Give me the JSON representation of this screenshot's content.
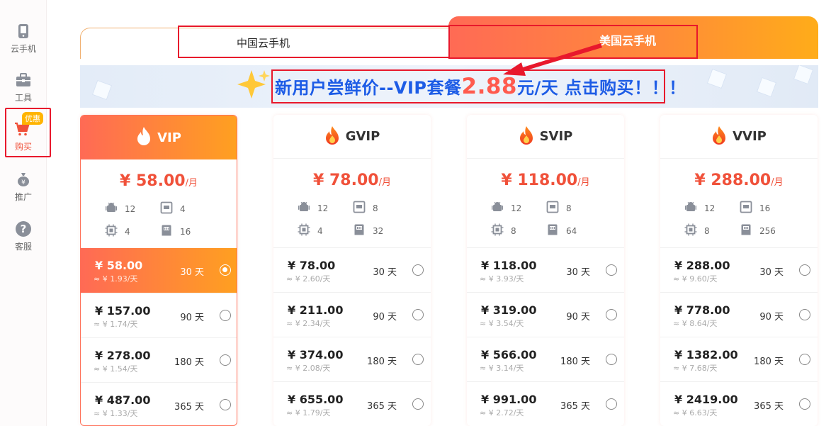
{
  "sidebar": {
    "items": [
      {
        "label": "云手机",
        "icon": "phone-icon"
      },
      {
        "label": "工具",
        "icon": "toolbox-icon"
      },
      {
        "label": "购买",
        "icon": "cart-icon",
        "badge": "优惠"
      },
      {
        "label": "推广",
        "icon": "money-bag-icon"
      },
      {
        "label": "客服",
        "icon": "help-icon"
      }
    ]
  },
  "tabs": {
    "china": "中国云手机",
    "usa": "美国云手机"
  },
  "banner": {
    "prefix": "新用户尝鲜价--VIP套餐",
    "price": "2.88",
    "suffix": "元/天  点击购买！！！"
  },
  "plans": [
    {
      "name": "VIP",
      "price": "¥ 58.00",
      "per": "/月",
      "specs": [
        "12",
        "4",
        "4",
        "16"
      ],
      "options": [
        {
          "amount": "¥ 58.00",
          "daily": "≈ ¥ 1.93/天",
          "days": "30 天",
          "selected": true
        },
        {
          "amount": "¥ 157.00",
          "daily": "≈ ¥ 1.74/天",
          "days": "90 天",
          "selected": false
        },
        {
          "amount": "¥ 278.00",
          "daily": "≈ ¥ 1.54/天",
          "days": "180 天",
          "selected": false
        },
        {
          "amount": "¥ 487.00",
          "daily": "≈ ¥ 1.33/天",
          "days": "365 天",
          "selected": false
        }
      ]
    },
    {
      "name": "GVIP",
      "price": "¥ 78.00",
      "per": "/月",
      "specs": [
        "12",
        "8",
        "4",
        "32"
      ],
      "options": [
        {
          "amount": "¥ 78.00",
          "daily": "≈ ¥ 2.60/天",
          "days": "30 天",
          "selected": false
        },
        {
          "amount": "¥ 211.00",
          "daily": "≈ ¥ 2.34/天",
          "days": "90 天",
          "selected": false
        },
        {
          "amount": "¥ 374.00",
          "daily": "≈ ¥ 2.08/天",
          "days": "180 天",
          "selected": false
        },
        {
          "amount": "¥ 655.00",
          "daily": "≈ ¥ 1.79/天",
          "days": "365 天",
          "selected": false
        }
      ]
    },
    {
      "name": "SVIP",
      "price": "¥ 118.00",
      "per": "/月",
      "specs": [
        "12",
        "8",
        "8",
        "64"
      ],
      "options": [
        {
          "amount": "¥ 118.00",
          "daily": "≈ ¥ 3.93/天",
          "days": "30 天",
          "selected": false
        },
        {
          "amount": "¥ 319.00",
          "daily": "≈ ¥ 3.54/天",
          "days": "90 天",
          "selected": false
        },
        {
          "amount": "¥ 566.00",
          "daily": "≈ ¥ 3.14/天",
          "days": "180 天",
          "selected": false
        },
        {
          "amount": "¥ 991.00",
          "daily": "≈ ¥ 2.72/天",
          "days": "365 天",
          "selected": false
        }
      ]
    },
    {
      "name": "VVIP",
      "price": "¥ 288.00",
      "per": "/月",
      "specs": [
        "12",
        "16",
        "8",
        "256"
      ],
      "options": [
        {
          "amount": "¥ 288.00",
          "daily": "≈ ¥ 9.60/天",
          "days": "30 天",
          "selected": false
        },
        {
          "amount": "¥ 778.00",
          "daily": "≈ ¥ 8.64/天",
          "days": "90 天",
          "selected": false
        },
        {
          "amount": "¥ 1382.00",
          "daily": "≈ ¥ 7.68/天",
          "days": "180 天",
          "selected": false
        },
        {
          "amount": "¥ 2419.00",
          "daily": "≈ ¥ 6.63/天",
          "days": "365 天",
          "selected": false
        }
      ]
    }
  ],
  "colors": {
    "accent": "#f0513a",
    "gradient_start": "#ff6a55",
    "gradient_end": "#ffa020",
    "annotation": "#e8182c",
    "banner_text": "#1d5ce6"
  }
}
